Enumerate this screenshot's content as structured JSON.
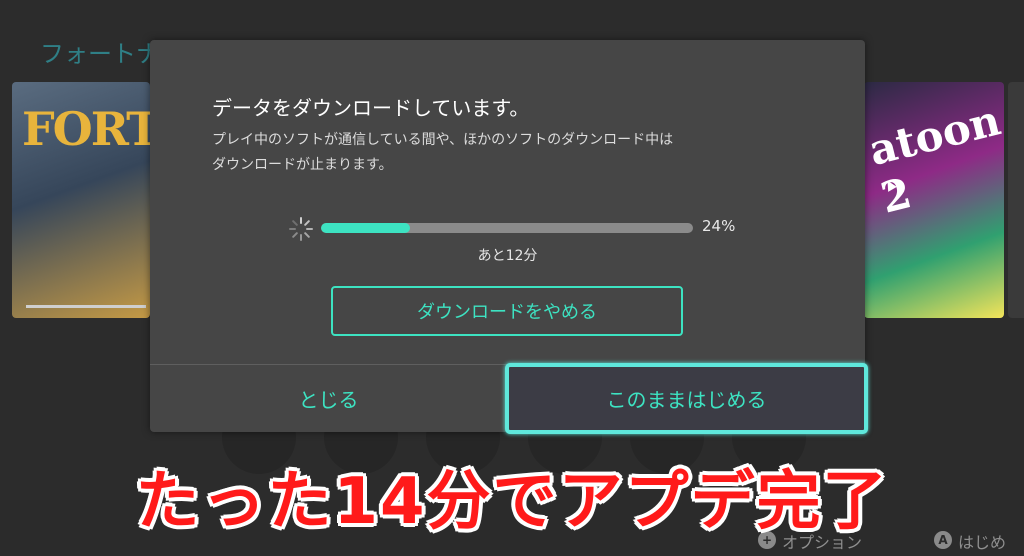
{
  "background": {
    "section_title": "フォートナ",
    "left_tile_text": "FORT",
    "right_tile_text": "atoon 2"
  },
  "dialog": {
    "title": "データをダウンロードしています。",
    "message_line1": "プレイ中のソフトが通信している間や、ほかのソフトのダウンロード中は",
    "message_line2": "ダウンロードが止まります。",
    "progress_percent": "24%",
    "progress_value": 0.24,
    "remaining": "あと12分",
    "stop_button": "ダウンロードをやめる",
    "close_button": "とじる",
    "start_button": "このままはじめる"
  },
  "footer": {
    "options_icon": "+",
    "options_label": "オプション",
    "start_icon": "A",
    "start_label": "はじめ"
  },
  "caption": "たった14分でアプデ完了",
  "colors": {
    "accent": "#3de3c2",
    "dialog_bg": "#464646",
    "caption_red": "#ff1a1a"
  }
}
